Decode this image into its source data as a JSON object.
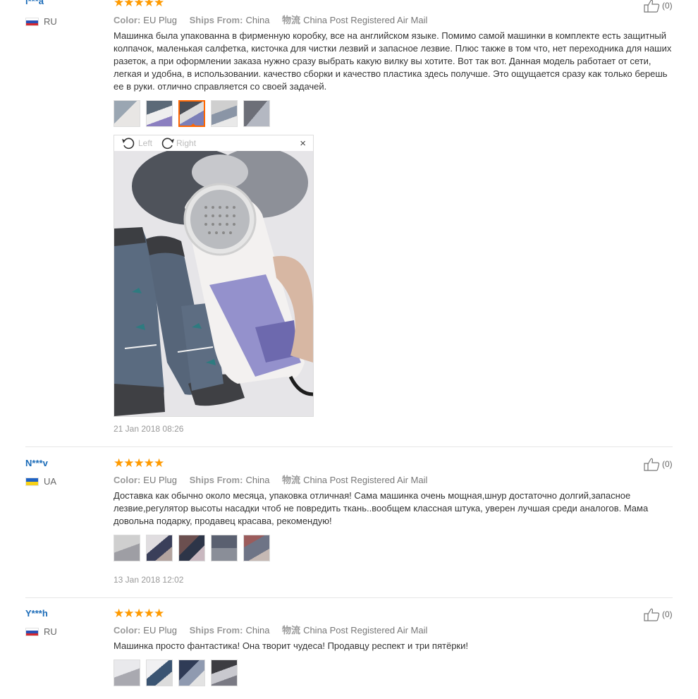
{
  "labels": {
    "color": "Color:",
    "ships_from": "Ships From:",
    "shipping": "物流",
    "left": "Left",
    "right": "Right",
    "close": "×"
  },
  "stars": "★★★★★",
  "reviews": [
    {
      "user": "l***a",
      "country": "RU",
      "color": "EU Plug",
      "ships_from": "China",
      "shipping": "China Post Registered Air Mail",
      "text": "Машинка была упакованна в фирменную коробку, все на английском языке. Помимо самой машинки в комплекте есть защитный колпачок, маленькая салфетка, кисточка для чистки лезвий и запасное лезвие. Плюс также в том что, нет переходника для наших разеток, а при оформлении заказа нужно сразу выбрать какую вилку вы хотите. Вот так вот. Данная модель работает от сети, легкая и удобна, в использовании. качество сборки и качество пластика здесь получше. Это ощущается сразу как только берешь ее в руки. отлично справляется со своей задачей.",
      "date": "21 Jan 2018 08:26",
      "helpful": "(0)"
    },
    {
      "user": "N***v",
      "country": "UA",
      "color": "EU Plug",
      "ships_from": "China",
      "shipping": "China Post Registered Air Mail",
      "text": "Доставка как обычно около месяца, упаковка отличная! Сама машинка очень мощная,шнур достаточно долгий,запасное лезвие,регулятор высоты насадки чтоб не повредить ткань..вообщем классная штука, уверен лучшая среди аналогов. Мама довольна подарку, продавец красава, рекомендую!",
      "date": "13 Jan 2018 12:02",
      "helpful": "(0)"
    },
    {
      "user": "Y***h",
      "country": "RU",
      "color": "EU Plug",
      "ships_from": "China",
      "shipping": "China Post Registered Air Mail",
      "text": "Машинка просто фантастика! Она творит чудеса! Продавцу респект и три пятёрки!",
      "helpful": "(0)"
    }
  ]
}
